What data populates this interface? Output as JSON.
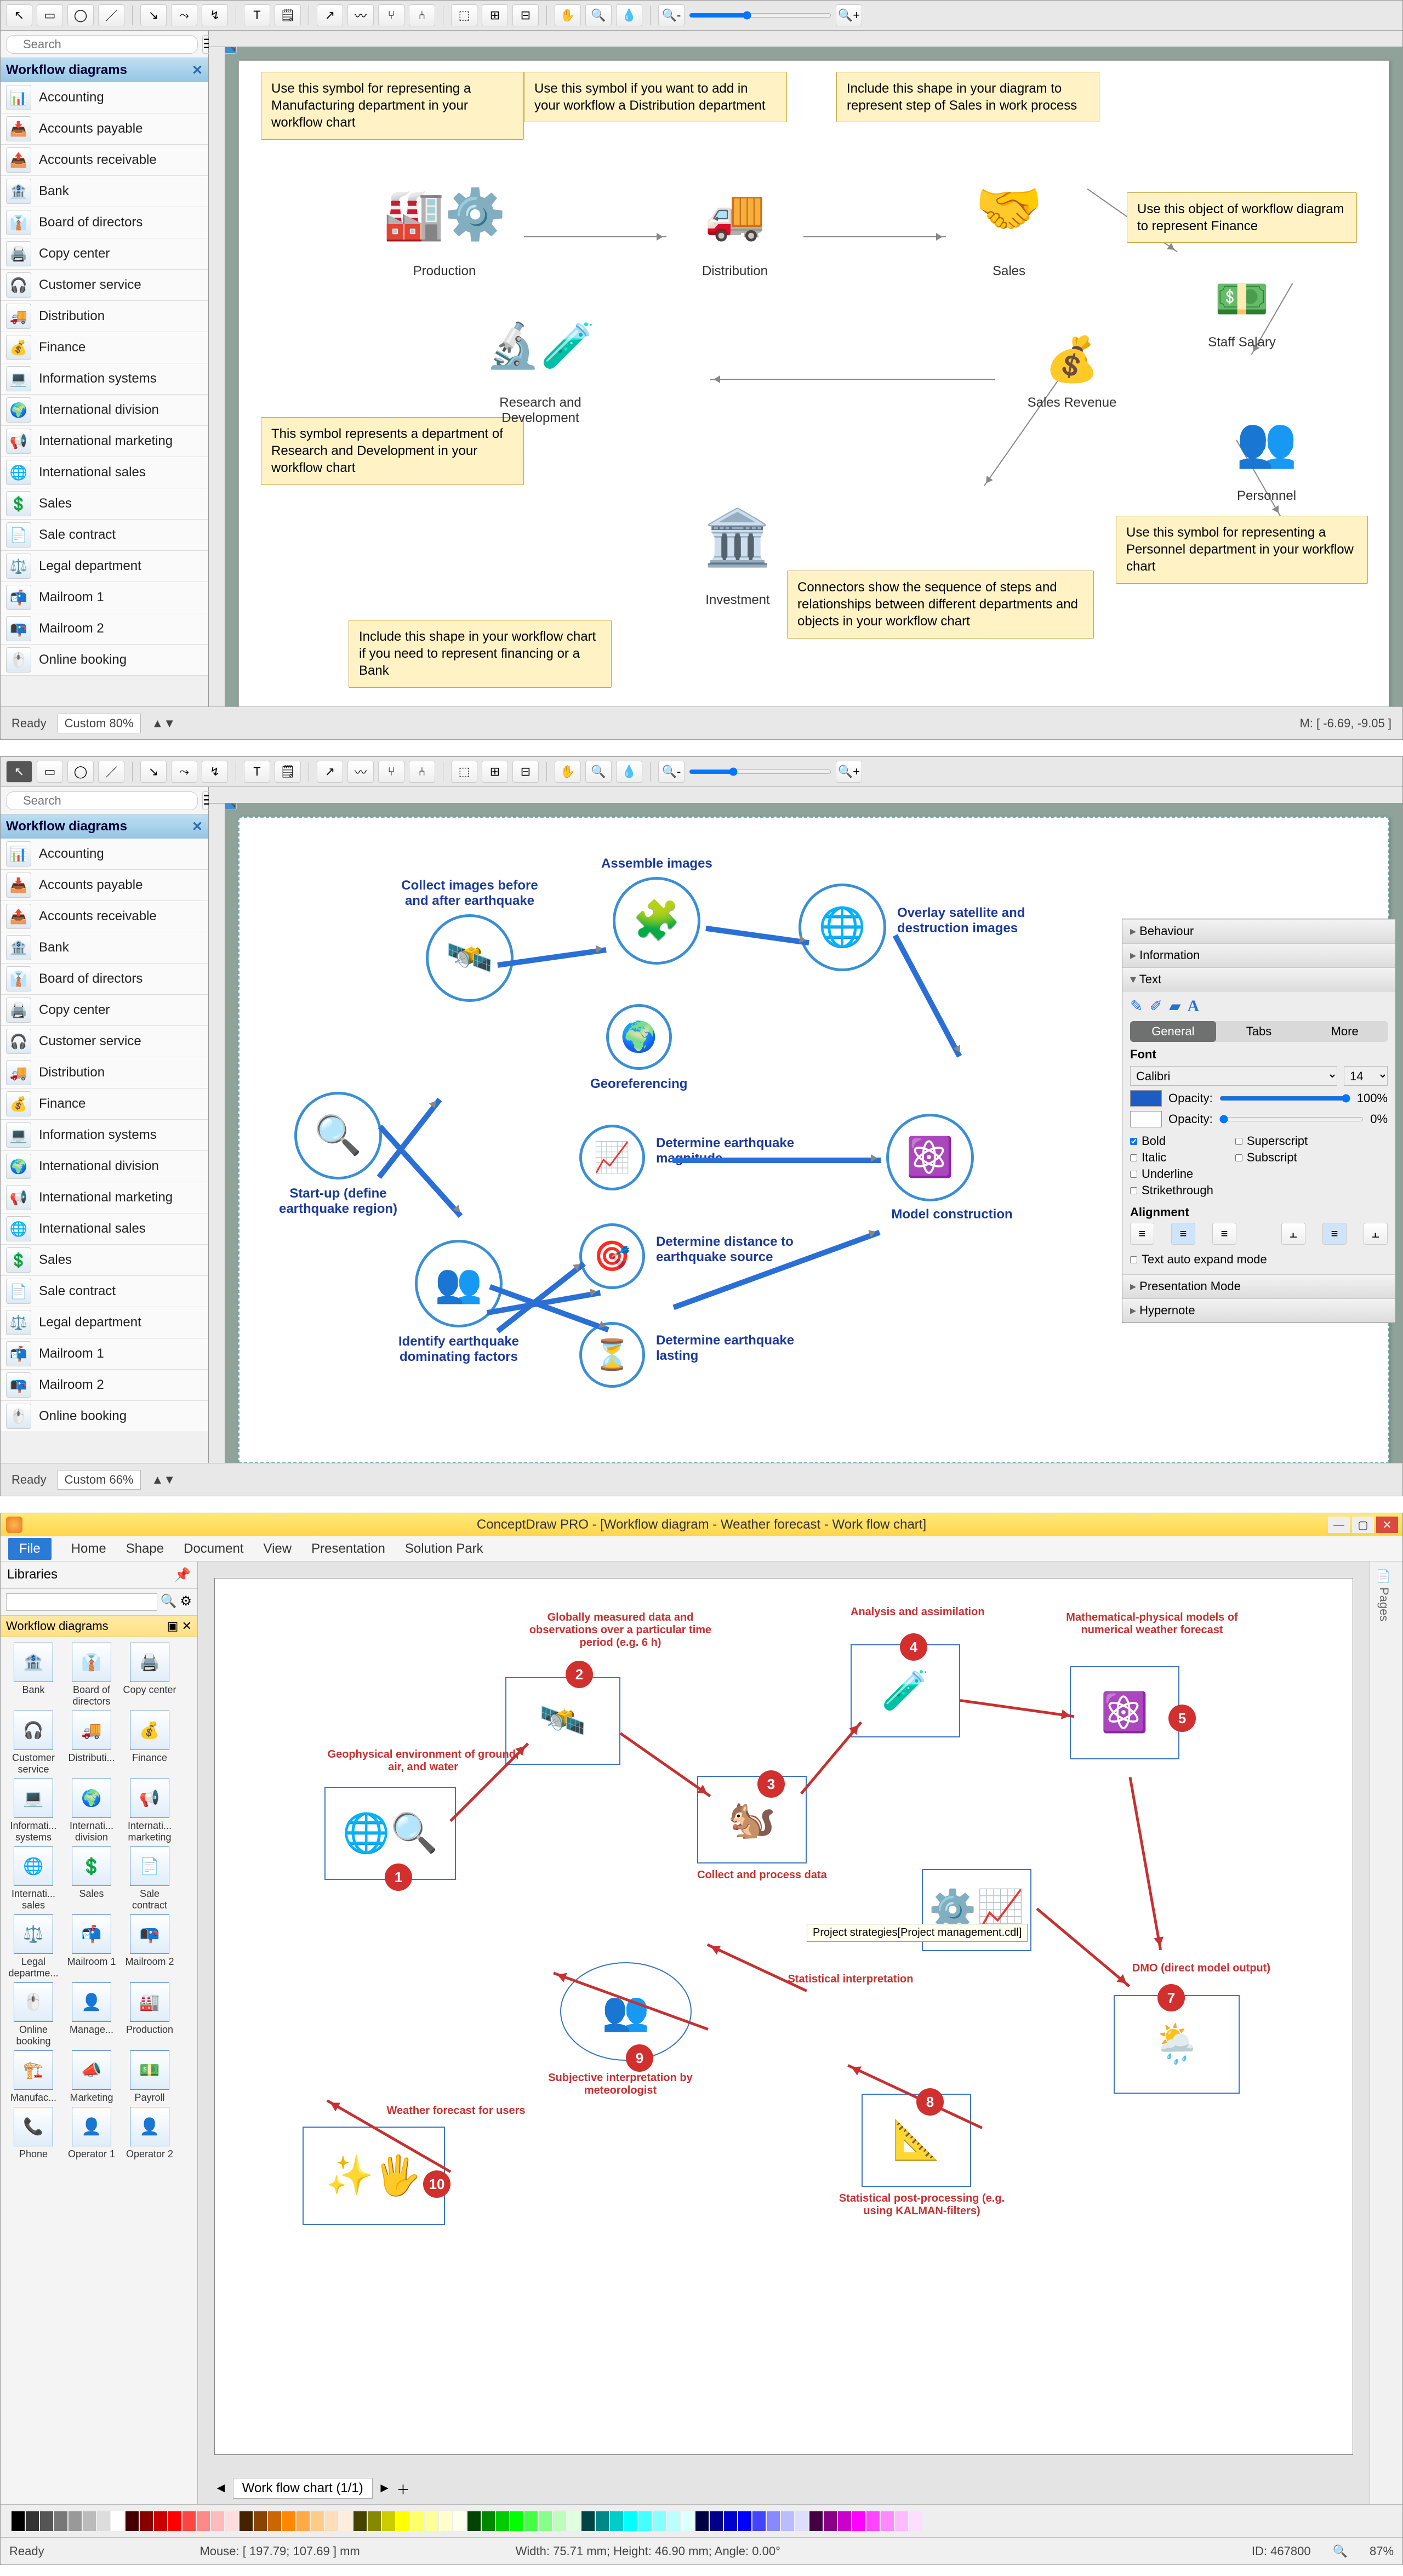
{
  "toolbar_zoom_label": "Zoom",
  "search_placeholder": "Search",
  "sidebar_title": "Workflow diagrams",
  "lib_items": [
    "Accounting",
    "Accounts payable",
    "Accounts receivable",
    "Bank",
    "Board of directors",
    "Copy center",
    "Customer service",
    "Distribution",
    "Finance",
    "Information systems",
    "International division",
    "International marketing",
    "International sales",
    "Sales",
    "Sale contract",
    "Legal department",
    "Mailroom 1",
    "Mailroom 2",
    "Online booking"
  ],
  "pane1": {
    "zoom": "Custom 80%",
    "mouse": "M: [ -6.69, -9.05 ]",
    "ready": "Ready",
    "notes": {
      "n1": "Use this symbol for representing a Manufacturing department in your workflow chart",
      "n2": "Use this symbol if you want to add in your workflow a Distribution department",
      "n3": "Include this shape in your diagram to represent step of Sales in work process",
      "n4": "Use this object of workflow diagram to represent Finance",
      "n5": "This symbol represents a department of Research and Development in your workflow chart",
      "n6": "Use this symbol for representing a Personnel department in your workflow chart",
      "n7": "Include this shape in your workflow chart if you need to represent financing or a Bank",
      "n8": "Connectors show the sequence of steps and relationships between different departments and objects in your workflow chart"
    },
    "nodes": {
      "production": "Production",
      "distribution": "Distribution",
      "sales": "Sales",
      "staff_salary": "Staff Salary",
      "sales_revenue": "Sales Revenue",
      "rd": "Research and Development",
      "personnel": "Personnel",
      "investment": "Investment"
    }
  },
  "pane2": {
    "zoom": "Custom 66%",
    "ready": "Ready",
    "nodes": {
      "startup": "Start-up (define earthquake region)",
      "collect": "Collect images before and after earthquake",
      "assemble": "Assemble images",
      "overlay": "Overlay satellite and destruction images",
      "georef": "Georeferencing",
      "magnitude": "Determine earthquake magnitude",
      "model": "Model construction",
      "distance": "Determine distance to earthquake source",
      "lasting": "Determine earthquake lasting",
      "identify": "Identify earthquake dominating factors"
    },
    "prop": {
      "sec_behaviour": "Behaviour",
      "sec_information": "Information",
      "sec_text": "Text",
      "tab_general": "General",
      "tab_tabs": "Tabs",
      "tab_more": "More",
      "font_label": "Font",
      "font_name": "Calibri",
      "font_size": "14",
      "opacity_label": "Opacity:",
      "opacity_text": "100%",
      "opacity_line": "0%",
      "bold": "Bold",
      "italic": "Italic",
      "underline": "Underline",
      "strike": "Strikethrough",
      "superscript": "Superscript",
      "subscript": "Subscript",
      "alignment": "Alignment",
      "auto_expand": "Text auto expand mode",
      "sec_pres": "Presentation Mode",
      "sec_hyper": "Hypernote"
    }
  },
  "pane3": {
    "title": "ConceptDraw PRO - [Workflow diagram - Weather forecast - Work flow chart]",
    "menus": [
      "File",
      "Home",
      "Shape",
      "Document",
      "View",
      "Presentation",
      "Solution Park"
    ],
    "libs_hdr": "Libraries",
    "lib_category": "Workflow diagrams",
    "grid": [
      "Bank",
      "Board of directors",
      "Copy center",
      "Customer service",
      "Distributi...",
      "Finance",
      "Informati... systems",
      "Internati... division",
      "Internati... marketing",
      "Internati... sales",
      "Sales",
      "Sale contract",
      "Legal departme...",
      "Mailroom 1",
      "Mailroom 2",
      "Online booking",
      "Manage...",
      "Production",
      "Manufac...",
      "Marketing",
      "Payroll",
      "Phone",
      "Operator 1",
      "Operator 2"
    ],
    "tab_name": "Work flow chart (1/1)",
    "status": {
      "ready": "Ready",
      "mouse": "Mouse: [ 197.79; 107.69 ] mm",
      "size": "Width: 75.71 mm; Height: 46.90 mm; Angle: 0.00°",
      "id": "ID: 467800",
      "zoom": "87%"
    },
    "labels": {
      "l1": "Geophysical environment of ground, air, and water",
      "l2": "Globally measured data and observations over a particular time period (e.g. 6 h)",
      "l3": "Collect and process data",
      "l4": "Analysis and assimilation",
      "l5": "Mathematical-physical models of numerical weather forecast",
      "l7": "DMO (direct model output)",
      "l8": "Statistical post-processing (e.g. using KALMAN-filters)",
      "l9a": "Statistical interpretation",
      "l9": "Subjective interpretation by meteorologist",
      "l10": "Weather forecast for users",
      "tooltip": "Project strategies[Project management.cdl]"
    }
  }
}
